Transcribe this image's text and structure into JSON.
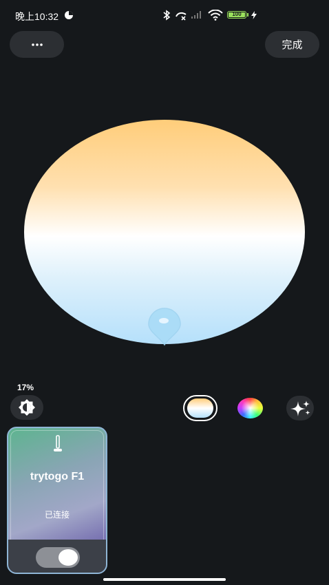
{
  "status_bar": {
    "time": "晚上10:32",
    "battery": "100"
  },
  "header": {
    "more_label": "···",
    "done_label": "完成"
  },
  "light": {
    "brightness": "17%",
    "mode_selected": "white-temperature"
  },
  "device": {
    "name": "trytogo F1",
    "status": "已连接",
    "power_on": true
  },
  "colors": {
    "background": "#15181b",
    "button_bg": "#2c2f33",
    "warm": "#ffcd7a",
    "cool": "#b5e0fb"
  }
}
